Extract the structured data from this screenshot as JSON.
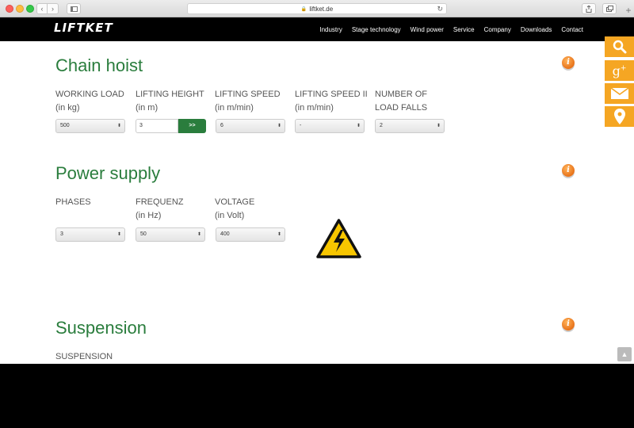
{
  "browser": {
    "url": "liftket.de",
    "nav_back": "‹",
    "nav_forward": "›",
    "reload": "↻",
    "new_tab": "+"
  },
  "site": {
    "logo": "LIFTKET",
    "nav": [
      "Industry",
      "Stage technology",
      "Wind power",
      "Service",
      "Company",
      "Downloads",
      "Contact"
    ]
  },
  "chain_hoist": {
    "title": "Chain hoist",
    "info": "i",
    "fields": [
      {
        "label1": "WORKING LOAD",
        "label2": "(in kg)",
        "value": "500"
      },
      {
        "label1": "LIFTING HEIGHT",
        "label2": "(in m)",
        "value": "3",
        "button": ">>"
      },
      {
        "label1": "LIFTING SPEED",
        "label2": "(in m/min)",
        "value": "6"
      },
      {
        "label1": "LIFTING SPEED II",
        "label2": "(in m/min)",
        "value": "-"
      },
      {
        "label1": "NUMBER OF",
        "label2": "LOAD FALLS",
        "value": "2"
      }
    ]
  },
  "power_supply": {
    "title": "Power supply",
    "info": "i",
    "fields": [
      {
        "label1": "PHASES",
        "label2": "",
        "value": "3"
      },
      {
        "label1": "FREQUENZ",
        "label2": "(in Hz)",
        "value": "50"
      },
      {
        "label1": "VOLTAGE",
        "label2": "(in Volt)",
        "value": "400"
      }
    ]
  },
  "suspension": {
    "title": "Suspension",
    "info": "i",
    "label": "SUSPENSION"
  },
  "icons": {
    "select_arrow": "⬍",
    "scroll_top": "▲"
  },
  "colors": {
    "accent_green": "#2a7d3d",
    "social_orange": "#f5a623",
    "warning_yellow": "#f7c600"
  }
}
